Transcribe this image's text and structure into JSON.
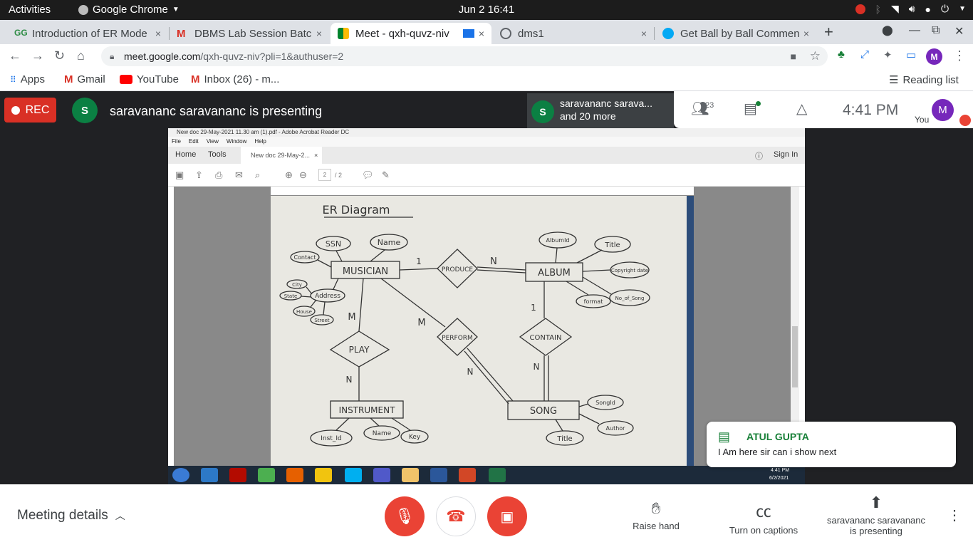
{
  "system": {
    "activities": "Activities",
    "app": "Google Chrome",
    "clock": "Jun 2  16:41"
  },
  "tabs": [
    {
      "title": "Introduction of ER Mode",
      "close": "×"
    },
    {
      "title": "DBMS Lab Session Batc",
      "close": "×"
    },
    {
      "title": "Meet - qxh-quvz-niv",
      "close": "×"
    },
    {
      "title": "dms1",
      "close": "×"
    },
    {
      "title": "Get Ball by Ball Commen",
      "close": "×"
    }
  ],
  "new_tab": "+",
  "address": {
    "domain": "meet.google.com",
    "path": "/qxh-quvz-niv?pli=1&authuser=2"
  },
  "profile": "M",
  "bookmarks": {
    "apps": "Apps",
    "gmail": "Gmail",
    "youtube": "YouTube",
    "inbox": "Inbox (26) - m...",
    "reading": "Reading list"
  },
  "meet": {
    "rec": "REC",
    "presenter_avatar": "S",
    "presenting": "saravananc saravananc is presenting",
    "pip_name": "saravananc sarava...",
    "pip_more": "and 20 more",
    "people_count": "23",
    "time": "4:41 PM",
    "you": "You",
    "you_avatar": "M"
  },
  "acrobat": {
    "title": "New doc 29-May-2021 11.30 am (1).pdf - Adobe Acrobat Reader DC",
    "menu": [
      "File",
      "Edit",
      "View",
      "Window",
      "Help"
    ],
    "home": "Home",
    "tools": "Tools",
    "doc_tab": "New doc 29-May-2...",
    "sign_in": "Sign In",
    "page": "2",
    "pages": "/ 2",
    "task_time": "4:41 PM",
    "task_date": "6/2/2021"
  },
  "er": {
    "title": "ER Diagram",
    "entities": [
      "MUSICIAN",
      "ALBUM",
      "INSTRUMENT",
      "SONG"
    ],
    "relations": [
      "PRODUCE",
      "PLAY",
      "PERFORM",
      "CONTAIN"
    ],
    "attrs": [
      "SSN",
      "Name",
      "Contact",
      "Address",
      "City",
      "State",
      "House",
      "Street",
      "AlbumId",
      "Title",
      "Copyright date",
      "No_of_Song",
      "format",
      "Inst_Id",
      "Name",
      "Key",
      "SongId",
      "Author",
      "Title"
    ],
    "card": [
      "1",
      "N",
      "M",
      "N",
      "M",
      "N",
      "1",
      "N"
    ]
  },
  "chat": {
    "name": "ATUL GUPTA",
    "message": "I Am here sir can i show next"
  },
  "bottom": {
    "details": "Meeting details",
    "raise": "Raise hand",
    "captions": "Turn on captions",
    "present": "saravananc saravananc\nis presenting"
  },
  "colors": {
    "meet_red": "#ea4335",
    "rec_red": "#d93025",
    "green": "#188038",
    "dark": "#202124"
  }
}
